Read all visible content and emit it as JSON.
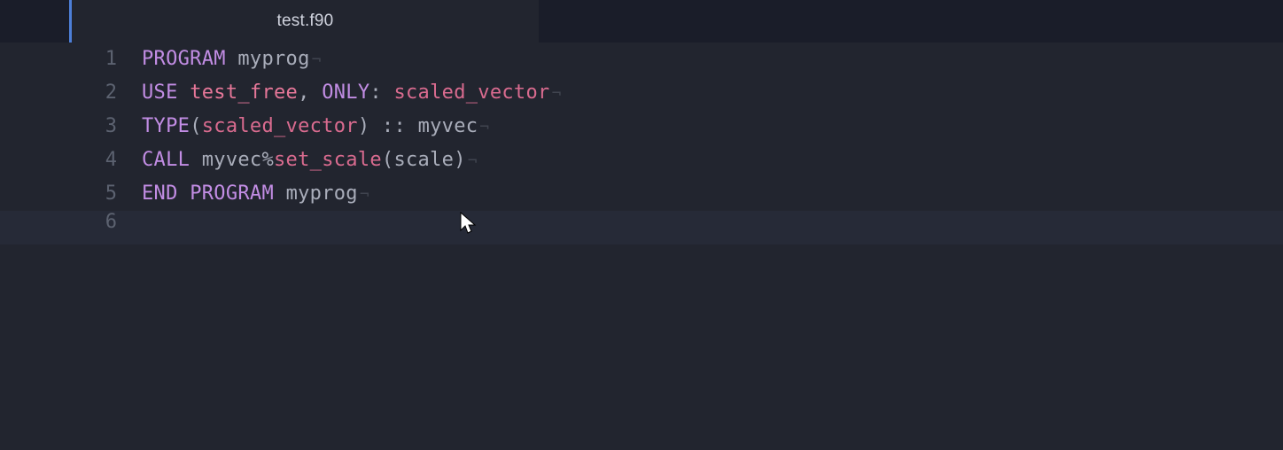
{
  "tab": {
    "title": "test.f90"
  },
  "lines": [
    {
      "n": "1"
    },
    {
      "n": "2"
    },
    {
      "n": "3"
    },
    {
      "n": "4"
    },
    {
      "n": "5"
    },
    {
      "n": "6"
    }
  ],
  "tok": {
    "l1": {
      "program": "PROGRAM",
      "sp": " ",
      "myprog": "myprog"
    },
    "l2": {
      "use": "USE",
      "sp": " ",
      "test_free": "test_free",
      "comma": ",",
      "sp2": " ",
      "only": "ONLY",
      "colon": ":",
      "sp3": " ",
      "scaled_vector": "scaled_vector"
    },
    "l3": {
      "type": "TYPE",
      "lp": "(",
      "scaled_vector": "scaled_vector",
      "rp": ")",
      "sp": " ",
      "dcolon": "::",
      "sp2": " ",
      "myvec": "myvec"
    },
    "l4": {
      "call": "CALL",
      "sp": " ",
      "myvec": "myvec",
      "pct": "%",
      "set_scale": "set_scale",
      "lp": "(",
      "scale": "scale",
      "rp": ")"
    },
    "l5": {
      "end": "END",
      "sp": " ",
      "program": "PROGRAM",
      "sp2": " ",
      "myprog": "myprog"
    }
  },
  "eol": "¬",
  "colors": {
    "keyword": "#c28de4",
    "identifier": "#a9adba",
    "function": "#d96b8f",
    "name": "#e67799",
    "bg": "#22252f",
    "gutter": "#1a1d29"
  }
}
